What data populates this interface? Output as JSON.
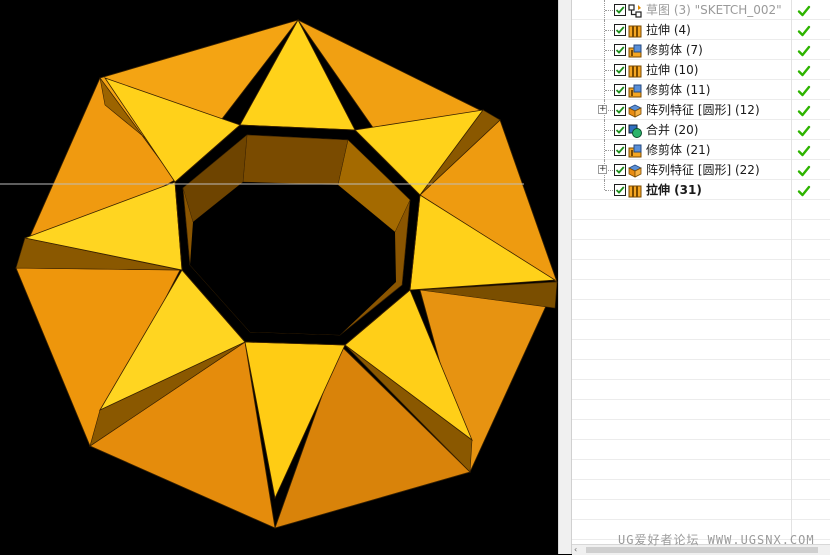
{
  "tree": {
    "items": [
      {
        "label": "草图 (3) \"SKETCH_002\"",
        "icon": "sketch-icon",
        "checked": true,
        "status": "ok",
        "dim": true,
        "bold": false,
        "expand": ""
      },
      {
        "label": "拉伸 (4)",
        "icon": "extrude-icon",
        "checked": true,
        "status": "ok",
        "dim": false,
        "bold": false,
        "expand": ""
      },
      {
        "label": "修剪体 (7)",
        "icon": "trim-body-icon",
        "checked": true,
        "status": "ok",
        "dim": false,
        "bold": false,
        "expand": ""
      },
      {
        "label": "拉伸 (10)",
        "icon": "extrude-icon",
        "checked": true,
        "status": "ok",
        "dim": false,
        "bold": false,
        "expand": ""
      },
      {
        "label": "修剪体 (11)",
        "icon": "trim-body-icon",
        "checked": true,
        "status": "ok",
        "dim": false,
        "bold": false,
        "expand": ""
      },
      {
        "label": "阵列特征 [圆形] (12)",
        "icon": "pattern-feature-icon",
        "checked": true,
        "status": "ok",
        "dim": false,
        "bold": false,
        "expand": "+"
      },
      {
        "label": "合并 (20)",
        "icon": "unite-icon",
        "checked": true,
        "status": "ok",
        "dim": false,
        "bold": false,
        "expand": ""
      },
      {
        "label": "修剪体 (21)",
        "icon": "trim-body-icon",
        "checked": true,
        "status": "ok",
        "dim": false,
        "bold": false,
        "expand": ""
      },
      {
        "label": "阵列特征 [圆形] (22)",
        "icon": "pattern-feature-icon",
        "checked": true,
        "status": "ok",
        "dim": false,
        "bold": false,
        "expand": "+"
      },
      {
        "label": "拉伸 (31)",
        "icon": "extrude-icon",
        "checked": true,
        "status": "ok",
        "dim": false,
        "bold": true,
        "expand": ""
      }
    ]
  },
  "watermark": "UG爱好者论坛 WWW.UGSNX.COM",
  "colors": {
    "viewport_bg": "#000000",
    "model_light": "#FFD11A",
    "model_mid": "#F29A0E",
    "model_dark": "#8A5800",
    "status_green": "#2DB400"
  }
}
